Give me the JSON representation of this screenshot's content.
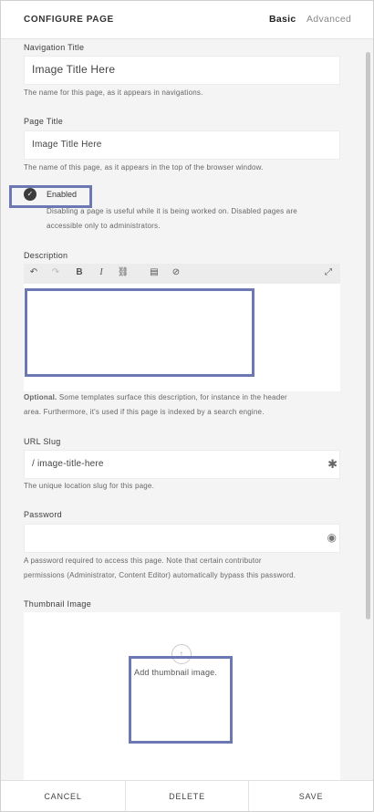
{
  "header": {
    "title": "CONFIGURE PAGE",
    "tabs": [
      {
        "label": "Basic",
        "active": true
      },
      {
        "label": "Advanced",
        "active": false
      }
    ]
  },
  "navigation_title": {
    "label": "Navigation Title",
    "value": "Image Title Here",
    "help": "The name for this page, as it appears in navigations."
  },
  "page_title": {
    "label": "Page Title",
    "value": "Image Title Here",
    "help": "The name of this page, as it appears in the top of the browser window."
  },
  "enabled": {
    "label": "Enabled",
    "checked": true,
    "help_line1": "Disabling a page is useful while it is being worked on. Disabled pages are",
    "help_line2": "accessible only to administrators."
  },
  "description": {
    "label": "Description",
    "toolbar": [
      "undo-icon",
      "redo-icon",
      "bold-icon",
      "italic-icon",
      "link-icon",
      "block-icon",
      "clear-format-icon",
      "expand-icon"
    ],
    "help_line1_bold": "Optional.",
    "help_line1": " Some templates surface this description, for instance in the header",
    "help_line2": "area. Furthermore, it's used if this page is indexed by a search engine."
  },
  "url_slug": {
    "label": "URL Slug",
    "value": "/ image-title-here",
    "help": "The unique location slug for this page."
  },
  "password": {
    "label": "Password",
    "value": "",
    "help_line1": "A password required to access this page. Note that certain contributor",
    "help_line2": "permissions (Administrator, Content Editor) automatically bypass this password."
  },
  "thumbnail": {
    "label": "Thumbnail Image",
    "add_label": "Add thumbnail image."
  },
  "footer": {
    "cancel": "CANCEL",
    "delete": "DELETE",
    "save": "SAVE"
  },
  "colors": {
    "highlight": "#6c78b3",
    "background": "#f4f4f4"
  }
}
